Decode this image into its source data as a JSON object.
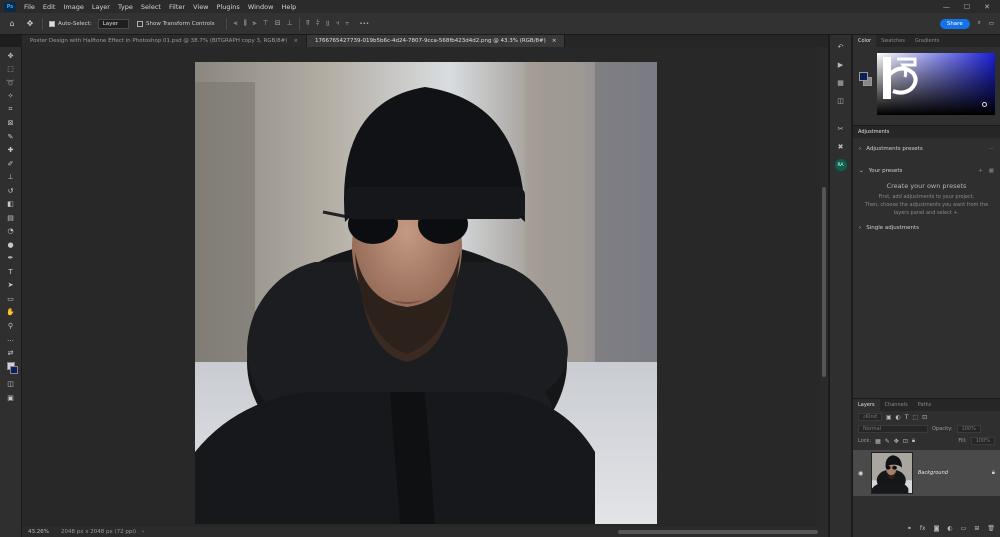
{
  "app": {
    "logo": "Ps"
  },
  "menu": [
    "File",
    "Edit",
    "Image",
    "Layer",
    "Type",
    "Select",
    "Filter",
    "View",
    "Plugins",
    "Window",
    "Help"
  ],
  "window_controls": {
    "minimize": "—",
    "maximize": "☐",
    "close": "✕"
  },
  "options_bar": {
    "auto_select_label": "Auto-Select:",
    "auto_select_checked": true,
    "layer_dropdown": "Layer",
    "show_transform_label": "Show Transform Controls",
    "show_transform_checked": false,
    "more": "•••",
    "share_label": "Share"
  },
  "tabs": [
    {
      "label": "Poster Design with Halftone Effect in Photoshop 01.psd @ 38.7% (BITGRAPH copy 3, RGB/8#)",
      "close": "×",
      "active": false
    },
    {
      "label": "1766765427739-019b5b6c-4d24-7807-9cca-568fb423d4d2.png @ 43.3% (RGB/8#)",
      "close": "×",
      "active": true
    }
  ],
  "status": {
    "zoom": "43.26%",
    "doc_info": "2048 px x 2048 px (72 ppi)"
  },
  "panels": {
    "color_tabs": [
      "Color",
      "Swatches",
      "Gradients"
    ],
    "adjustments": {
      "tab": "Adjustments",
      "presets_label": "Adjustments presets",
      "your_presets_label": "Your presets",
      "create_title": "Create your own presets",
      "create_desc_1": "First, add adjustments to your project.",
      "create_desc_2": "Then, choose the adjustments you want from the",
      "create_desc_3": "layers panel and select +.",
      "single_label": "Single adjustments"
    },
    "layers": {
      "tabs": [
        "Layers",
        "Channels",
        "Paths"
      ],
      "kind_placeholder": "Kind",
      "blend_mode": "Normal",
      "opacity_label": "Opacity:",
      "opacity_value": "100%",
      "lock_label": "Lock:",
      "fill_label": "Fill:",
      "fill_value": "100%",
      "layer_name": "Background"
    }
  },
  "accent": "#1473e6"
}
